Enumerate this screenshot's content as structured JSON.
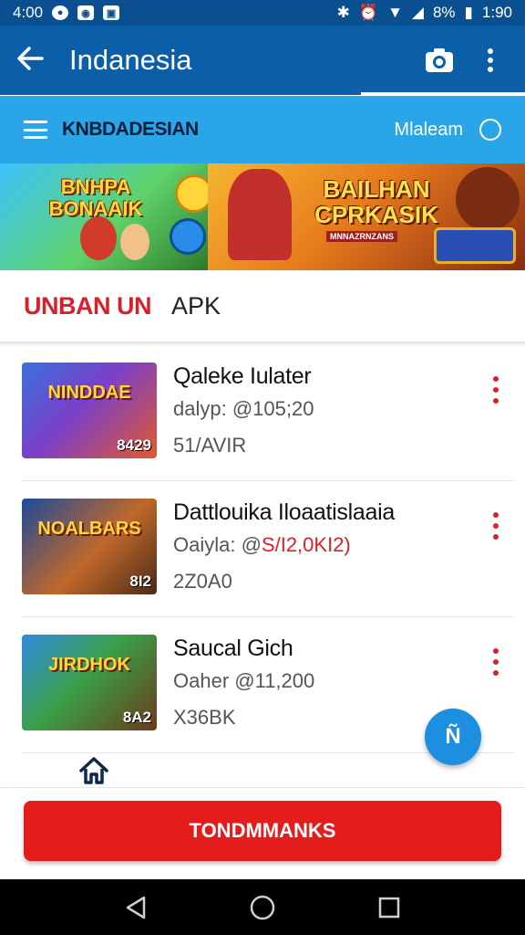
{
  "status_bar": {
    "time_left": "4:00",
    "battery": "8%",
    "time_right": "1:90"
  },
  "app_bar": {
    "title": "Indanesia",
    "back_icon": "arrow-left-icon",
    "camera_icon": "camera-icon",
    "menu_icon": "more-vert-icon"
  },
  "sub_bar": {
    "title": "KNBDADESIAN",
    "link": "Mlaleam"
  },
  "banner": {
    "left_title": "BNHPA BONAAIK",
    "right_title": "BAILHAN CPRKASIK",
    "right_sub": "MNNAZRNZANS"
  },
  "section": {
    "accent": "UNBAN UN",
    "label": "APK"
  },
  "items": [
    {
      "thumb_title": "NINDDAE",
      "thumb_badge": "8429",
      "name": "Qaleke Iulater",
      "meta_prefix": "dalyp: @105;20",
      "meta_highlight": "",
      "size": "51/AVIR"
    },
    {
      "thumb_title": "NOALBARS",
      "thumb_badge": "8I2",
      "name": "Dattlouika Iloaatislaaia",
      "meta_prefix": "Oaiyla: @",
      "meta_highlight": "S/I2,0KI2)",
      "size": "2Z0A0"
    },
    {
      "thumb_title": "JIRDHOK",
      "thumb_badge": "8A2",
      "name": "Saucal Gich",
      "meta_prefix": "Oaher @11,200",
      "meta_highlight": "",
      "size": "X36BK"
    }
  ],
  "fab": {
    "label": "Ñ"
  },
  "cta": {
    "label": "TONDMMANKS"
  },
  "colors": {
    "app_bar": "#0b5ea8",
    "sub_bar": "#2aa6e8",
    "accent_red": "#d8222a",
    "cta_red": "#e51c1c",
    "fab_blue": "#1e8fe0"
  }
}
